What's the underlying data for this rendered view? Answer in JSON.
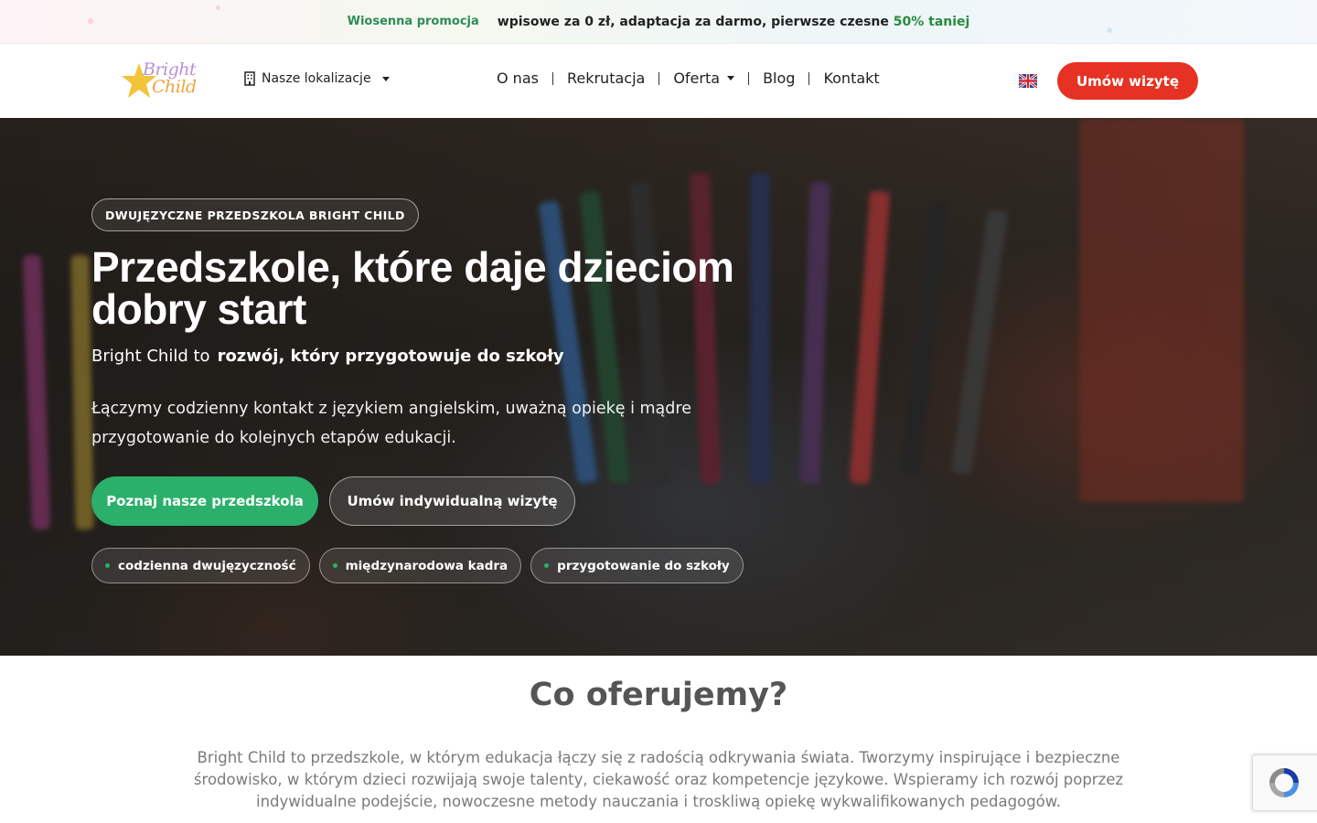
{
  "promo": {
    "tag": "Wiosenna promocja",
    "text": "wpisowe za 0 zł, adaptacja za darmo, pierwsze czesne",
    "highlight": "50% taniej"
  },
  "header": {
    "logo_line1": "Bright",
    "logo_line2": "Child",
    "locations_label": "Nasze lokalizacje",
    "nav": [
      "O nas",
      "Rekrutacja",
      "Oferta",
      "Blog",
      "Kontakt"
    ],
    "language_flag": "uk-flag-icon",
    "cta_label": "Umów wizytę"
  },
  "hero": {
    "eyebrow": "DWUJĘZYCZNE PRZEDSZKOLA BRIGHT CHILD",
    "title": "Przedszkole, które daje dzieciom dobry start",
    "subtitle_lead": "Bright Child to",
    "subtitle_strong": "rozwój, który przygotowuje do szkoły",
    "lead": "Łączymy codzienny kontakt z językiem angielskim, uważną opiekę i mądre przygotowanie do kolejnych etapów edukacji.",
    "primary_button": "Poznaj nasze przedszkola",
    "secondary_button": "Umów indywidualną wizytę",
    "chips": [
      "codzienna dwujęzyczność",
      "międzynarodowa kadra",
      "przygotowanie do szkoły"
    ]
  },
  "offer": {
    "title": "Co oferujemy?",
    "text": "Bright Child to przedszkole, w którym edukacja łączy się z radością odkrywania świata. Tworzymy inspirujące i bezpieczne środowisko, w którym dzieci rozwijają swoje talenty, ciekawość oraz kompetencje językowe. Wspieramy ich rozwój poprzez indywidualne podejście, nowoczesne metody nauczania i troskliwą opiekę wykwalifikowanych pedagogów."
  },
  "colors": {
    "accent_red": "#e63222",
    "accent_green": "#2bb06b",
    "promo_green": "#2a8a3c"
  }
}
